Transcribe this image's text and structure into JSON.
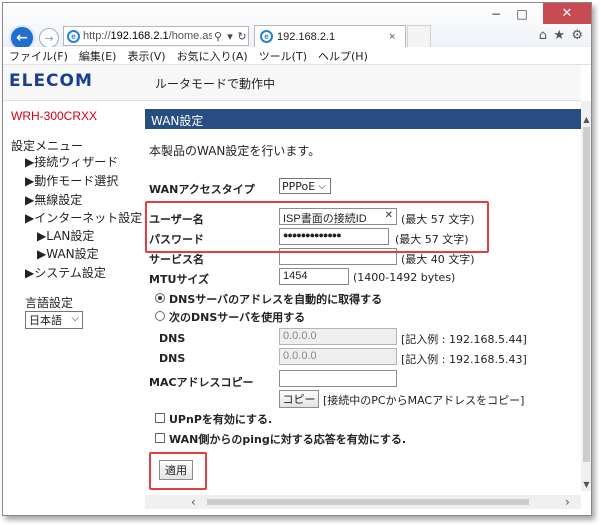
{
  "browser": {
    "address": {
      "prefix": "http://",
      "host": "192.168.2.1",
      "path": "/home.as"
    },
    "addr_search_icon": "search-icon",
    "addr_refresh_icon": "refresh-icon",
    "tab_title": "192.168.2.1",
    "tab_close": "×",
    "icons": {
      "back": "arrow-left-icon",
      "forward": "arrow-right-icon",
      "home": "home-icon",
      "favorites": "star-icon",
      "tools": "gear-icon"
    }
  },
  "window": {
    "minimize": "−",
    "maximize": "□",
    "close": "✕"
  },
  "menubar": [
    "ファイル(F)",
    "編集(E)",
    "表示(V)",
    "お気に入り(A)",
    "ツール(T)",
    "ヘルプ(H)"
  ],
  "header": {
    "logo": "ELECOM",
    "mode": "ルータモードで動作中"
  },
  "sidebar": {
    "model": "WRH-300CRXX",
    "menu_title": "設定メニュー",
    "items": [
      {
        "label": "▶接続ウィザード"
      },
      {
        "label": "▶動作モード選択"
      },
      {
        "label": "▶無線設定"
      },
      {
        "label": "▶インターネット設定"
      },
      {
        "label": "▶LAN設定"
      },
      {
        "label": "▶WAN設定"
      },
      {
        "label": "▶システム設定"
      }
    ],
    "language_title": "言語設定",
    "language_value": "日本語"
  },
  "main": {
    "section_title": "WAN設定",
    "intro": "本製品のWAN設定を行います。",
    "access_type_label": "WANアクセスタイプ",
    "access_type_value": "PPPoE",
    "username_label": "ユーザー名",
    "username_value": "ISP書面の接続ID",
    "username_note": "(最大 57 文字)",
    "password_label": "パスワード",
    "password_value": "●●●●●●●●●●●●●",
    "password_note": "(最大 57 文字)",
    "service_label": "サービス名",
    "service_note": "(最大 40 文字)",
    "mtu_label": "MTUサイズ",
    "mtu_value": "1454",
    "mtu_note": "(1400-1492 bytes)",
    "dns_auto_label": "DNSサーバのアドレスを自動的に取得する",
    "dns_manual_label": "次のDNSサーバを使用する",
    "dns1_label": "DNS",
    "dns1_value": "0.0.0.0",
    "dns1_note": "[記入例 : 192.168.5.44]",
    "dns2_label": "DNS",
    "dns2_value": "0.0.0.0",
    "dns2_note": "[記入例 : 192.168.5.43]",
    "mac_label": "MACアドレスコピー",
    "mac_value": "",
    "copy_button": "コピー",
    "copy_note": "[接続中のPCからMACアドレスをコピー]",
    "upnp_label": "UPnPを有効にする.",
    "ping_label": "WAN側からのpingに対する応答を有効にする.",
    "apply_button": "適用"
  },
  "colors": {
    "accent": "#274d82",
    "model_red": "#d8000f",
    "highlight": "#e0403f",
    "logo": "#1b3f8f"
  }
}
